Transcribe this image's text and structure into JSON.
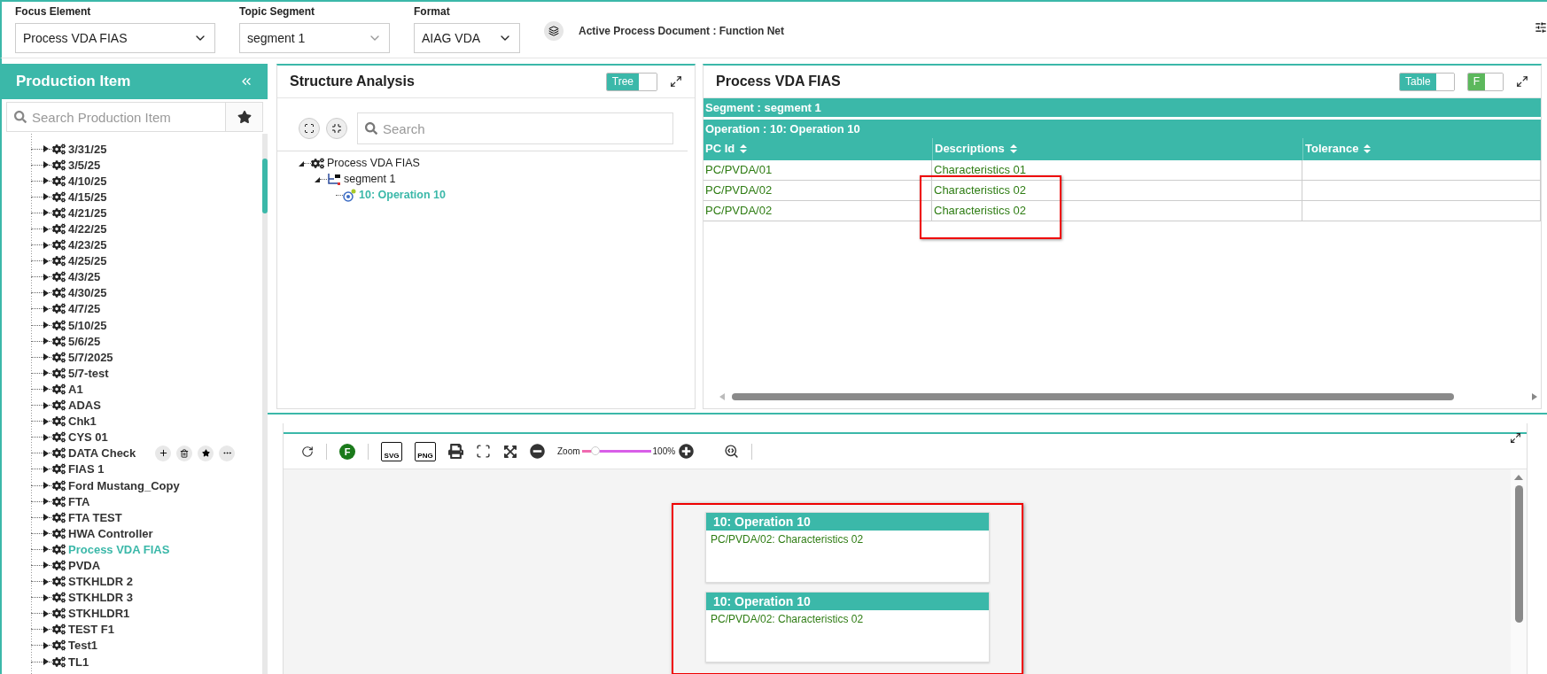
{
  "filters": [
    {
      "label": "Focus Element",
      "value": "Process VDA FIAS"
    },
    {
      "label": "Topic Segment",
      "value": "segment 1"
    },
    {
      "label": "Format",
      "value": "AIAG VDA"
    }
  ],
  "active_document": "Active Process Document : Function Net",
  "sidebar": {
    "title": "Production Item",
    "search": {
      "placeholder": "Search Production Item"
    },
    "items": [
      {
        "label": "3/31/25",
        "selected": false,
        "hovered": false
      },
      {
        "label": "3/5/25",
        "selected": false,
        "hovered": false
      },
      {
        "label": "4/10/25",
        "selected": false,
        "hovered": false
      },
      {
        "label": "4/15/25",
        "selected": false,
        "hovered": false
      },
      {
        "label": "4/21/25",
        "selected": false,
        "hovered": false
      },
      {
        "label": "4/22/25",
        "selected": false,
        "hovered": false
      },
      {
        "label": "4/23/25",
        "selected": false,
        "hovered": false
      },
      {
        "label": "4/25/25",
        "selected": false,
        "hovered": false
      },
      {
        "label": "4/3/25",
        "selected": false,
        "hovered": false
      },
      {
        "label": "4/30/25",
        "selected": false,
        "hovered": false
      },
      {
        "label": "4/7/25",
        "selected": false,
        "hovered": false
      },
      {
        "label": "5/10/25",
        "selected": false,
        "hovered": false
      },
      {
        "label": "5/6/25",
        "selected": false,
        "hovered": false
      },
      {
        "label": "5/7/2025",
        "selected": false,
        "hovered": false
      },
      {
        "label": "5/7-test",
        "selected": false,
        "hovered": false
      },
      {
        "label": "A1",
        "selected": false,
        "hovered": false
      },
      {
        "label": "ADAS",
        "selected": false,
        "hovered": false
      },
      {
        "label": "Chk1",
        "selected": false,
        "hovered": false
      },
      {
        "label": "CYS 01",
        "selected": false,
        "hovered": false
      },
      {
        "label": "DATA Check",
        "selected": false,
        "hovered": true
      },
      {
        "label": "FIAS 1",
        "selected": false,
        "hovered": false
      },
      {
        "label": "Ford Mustang_Copy",
        "selected": false,
        "hovered": false
      },
      {
        "label": "FTA",
        "selected": false,
        "hovered": false
      },
      {
        "label": "FTA TEST",
        "selected": false,
        "hovered": false
      },
      {
        "label": "HWA Controller",
        "selected": false,
        "hovered": false
      },
      {
        "label": "Process VDA FIAS",
        "selected": true,
        "hovered": false
      },
      {
        "label": "PVDA",
        "selected": false,
        "hovered": false
      },
      {
        "label": "STKHLDR 2",
        "selected": false,
        "hovered": false
      },
      {
        "label": "STKHLDR 3",
        "selected": false,
        "hovered": false
      },
      {
        "label": "STKHLDR1",
        "selected": false,
        "hovered": false
      },
      {
        "label": "TEST F1",
        "selected": false,
        "hovered": false
      },
      {
        "label": "Test1",
        "selected": false,
        "hovered": false
      },
      {
        "label": "TL1",
        "selected": false,
        "hovered": false
      }
    ]
  },
  "structure": {
    "title": "Structure Analysis",
    "toggle": {
      "label": "Tree",
      "on": true
    },
    "search": {
      "placeholder": "Search"
    },
    "tree": [
      {
        "label": "Process VDA FIAS",
        "kind": "product",
        "selected": false,
        "children": [
          {
            "label": "segment 1",
            "kind": "segment",
            "selected": false,
            "children": [
              {
                "label": "10: Operation 10",
                "kind": "operation",
                "selected": true
              }
            ]
          }
        ]
      }
    ]
  },
  "table_panel": {
    "title": "Process VDA FIAS",
    "toggles": [
      {
        "label": "Table",
        "on": true,
        "color": "#3bb8a9"
      },
      {
        "label": "F",
        "on": true,
        "color": "#5cb85c"
      }
    ],
    "segment": "Segment : segment 1",
    "operation": "Operation : 10: Operation 10",
    "columns": [
      "PC Id",
      "Descriptions",
      "Tolerance"
    ],
    "rows": [
      {
        "pc_id": "PC/PVDA/01",
        "description": "Characteristics 01",
        "highlighted": false
      },
      {
        "pc_id": "PC/PVDA/02",
        "description": "Characteristics 02",
        "highlighted": true
      },
      {
        "pc_id": "PC/PVDA/02",
        "description": "Characteristics 02",
        "highlighted": true
      }
    ]
  },
  "diagram": {
    "toolbar": {
      "function_button": "F",
      "exports": [
        "SVG",
        "PNG"
      ],
      "zoom_label": "Zoom",
      "zoom": {
        "level": 0.2
      },
      "zoom_value": "100%"
    },
    "highlighted": true,
    "cards": [
      {
        "title": "10: Operation 10",
        "lines": [
          "PC/PVDA/02: Characteristics 02"
        ]
      },
      {
        "title": "10: Operation 10",
        "lines": [
          "PC/PVDA/02: Characteristics 02"
        ]
      }
    ]
  }
}
